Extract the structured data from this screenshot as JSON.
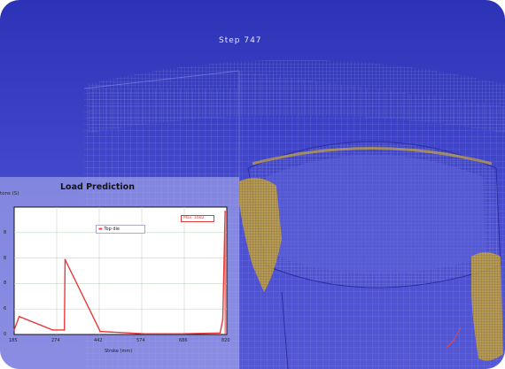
{
  "viewport": {
    "step_label": "Step 747",
    "background_color": "#3a3fc4",
    "mesh_line_color": "#8c90ea",
    "material_highlight_color": "#d6b23a"
  },
  "chart_data": {
    "type": "line",
    "title": "Load Prediction",
    "ylabel": "tons (S)",
    "xlabel": "Stroke (mm)",
    "x_ticks": [
      "185",
      "274",
      "442",
      "574",
      "686",
      "820"
    ],
    "y_ticks": [
      "0",
      "6",
      "8",
      "8",
      "8"
    ],
    "legend_entry": "Top die",
    "marker_label": "Max. 1682",
    "series": [
      {
        "name": "Top die",
        "color": "#e83a3a",
        "x": [
          185,
          200,
          300,
          335,
          337,
          442,
          574,
          686,
          800,
          808,
          815
        ],
        "y": [
          0.3,
          1.2,
          0.3,
          0.3,
          5.0,
          0.2,
          0.05,
          0.05,
          0.1,
          1.0,
          8.2
        ]
      }
    ],
    "xlim": [
      185,
      820
    ],
    "ylim": [
      0,
      8.5
    ],
    "grid": true
  }
}
